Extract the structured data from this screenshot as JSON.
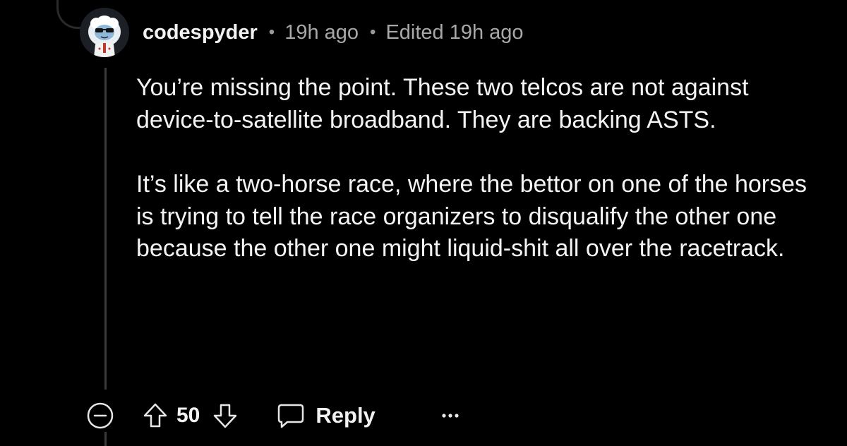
{
  "comment": {
    "username": "codespyder",
    "timestamp": "19h ago",
    "edited": "Edited 19h ago",
    "separator": "•",
    "paragraphs": [
      "You’re missing the point. These two telcos are not against device-to-satellite broadband. They are backing ASTS.",
      "It’s like a two-horse race, where the bettor on one of the horses is trying to tell the race organizers to disqualify the other one because the other one might liquid-shit all over the racetrack."
    ]
  },
  "actions": {
    "score": "50",
    "reply_label": "Reply"
  },
  "icons": {
    "collapse": "minus-circle-icon",
    "upvote": "arrow-up-icon",
    "downvote": "arrow-down-icon",
    "reply": "speech-bubble-icon",
    "more": "ellipsis-icon"
  },
  "colors": {
    "background": "#000000",
    "text": "#f4f4f4",
    "meta": "#a8a8a8",
    "thread_line": "#3a3a3a"
  }
}
